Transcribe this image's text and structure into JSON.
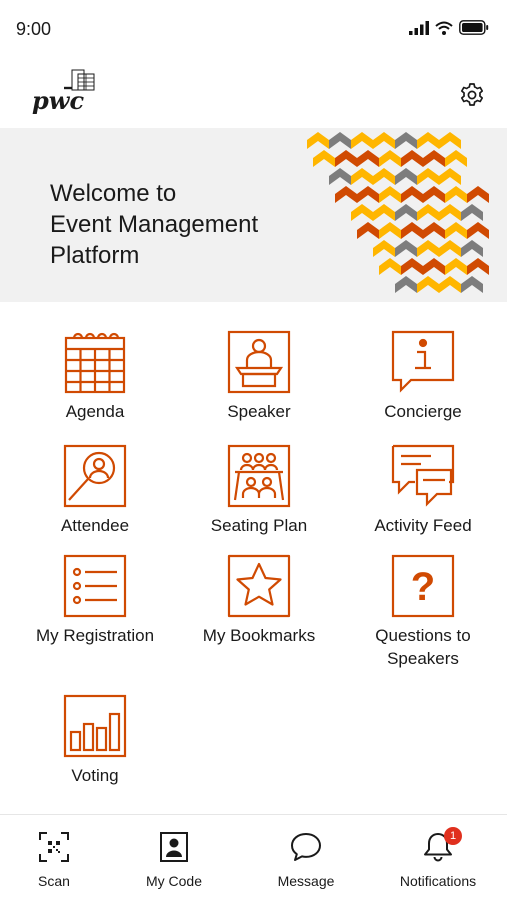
{
  "status_bar": {
    "time": "9:00"
  },
  "header": {
    "logo_text": "pwc",
    "settings_icon": "gear-icon"
  },
  "banner": {
    "title_line1": "Welcome to",
    "title_line2": "Event Management",
    "title_line3": "Platform"
  },
  "colors": {
    "accent": "#d04a02",
    "banner_bg": "#f1f1f1",
    "badge": "#e0301e",
    "pattern_yellow": "#ffb600",
    "pattern_gray": "#7d7d7d",
    "pattern_red": "#d04a02"
  },
  "menu": [
    {
      "label": "Agenda",
      "icon": "calendar-icon"
    },
    {
      "label": "Speaker",
      "icon": "podium-icon"
    },
    {
      "label": "Concierge",
      "icon": "info-icon"
    },
    {
      "label": "Attendee",
      "icon": "magnifier-person-icon"
    },
    {
      "label": "Seating Plan",
      "icon": "seating-icon"
    },
    {
      "label": "Activity Feed",
      "icon": "chat-bubbles-icon"
    },
    {
      "label": "My Registration",
      "icon": "checklist-icon"
    },
    {
      "label": "My Bookmarks",
      "icon": "star-icon"
    },
    {
      "label": "Questions to Speakers",
      "icon": "question-icon"
    },
    {
      "label": "Voting",
      "icon": "bar-chart-icon"
    }
  ],
  "tabs": [
    {
      "label": "Scan",
      "icon": "qr-scan-icon"
    },
    {
      "label": "My Code",
      "icon": "id-card-icon"
    },
    {
      "label": "Message",
      "icon": "message-icon"
    },
    {
      "label": "Notifications",
      "icon": "bell-icon",
      "badge": "1"
    }
  ]
}
